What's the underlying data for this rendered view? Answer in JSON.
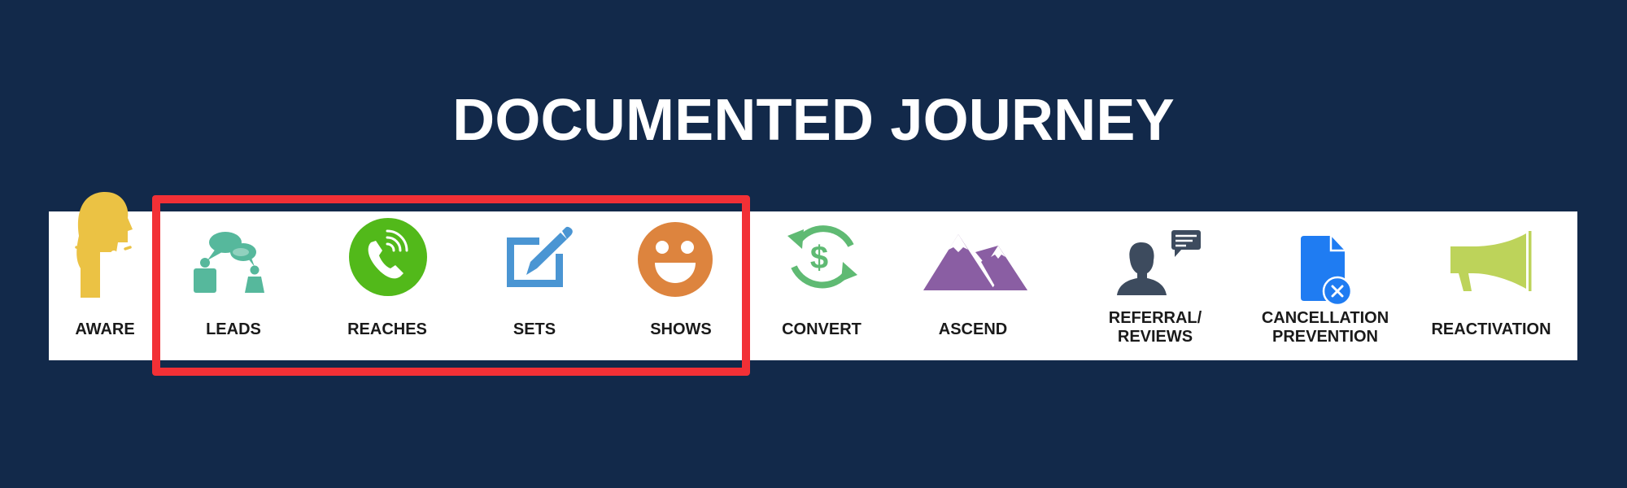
{
  "title": "DOCUMENTED JOURNEY",
  "colors": {
    "background": "#12294a",
    "strip": "#ffffff",
    "highlight": "#f23036",
    "label": "#1a1a1a"
  },
  "highlight": {
    "covers": [
      "LEADS",
      "REACHES",
      "SETS",
      "SHOWS"
    ]
  },
  "stages": [
    {
      "label": "AWARE",
      "icon": "head-idea-icon",
      "color": "#ebc244"
    },
    {
      "label": "LEADS",
      "icon": "people-conversation-icon",
      "color": "#56b89c"
    },
    {
      "label": "REACHES",
      "icon": "phone-call-icon",
      "color": "#52b91a"
    },
    {
      "label": "SETS",
      "icon": "edit-icon",
      "color": "#4a95d3"
    },
    {
      "label": "SHOWS",
      "icon": "smiley-icon",
      "color": "#dd843e"
    },
    {
      "label": "CONVERT",
      "icon": "dollar-exchange-icon",
      "color": "#5fba73"
    },
    {
      "label": "ASCEND",
      "icon": "mountains-icon",
      "color": "#8a5ea3"
    },
    {
      "label_lines": [
        "REFERRAL/",
        "REVIEWS"
      ],
      "icon": "person-comment-icon",
      "color": "#3d4b5e"
    },
    {
      "label_lines": [
        "CANCELLATION",
        "PREVENTION"
      ],
      "icon": "document-cancel-icon",
      "color": "#1f7cf2"
    },
    {
      "label": "REACTIVATION",
      "icon": "megaphone-icon",
      "color": "#bdd35a"
    }
  ]
}
